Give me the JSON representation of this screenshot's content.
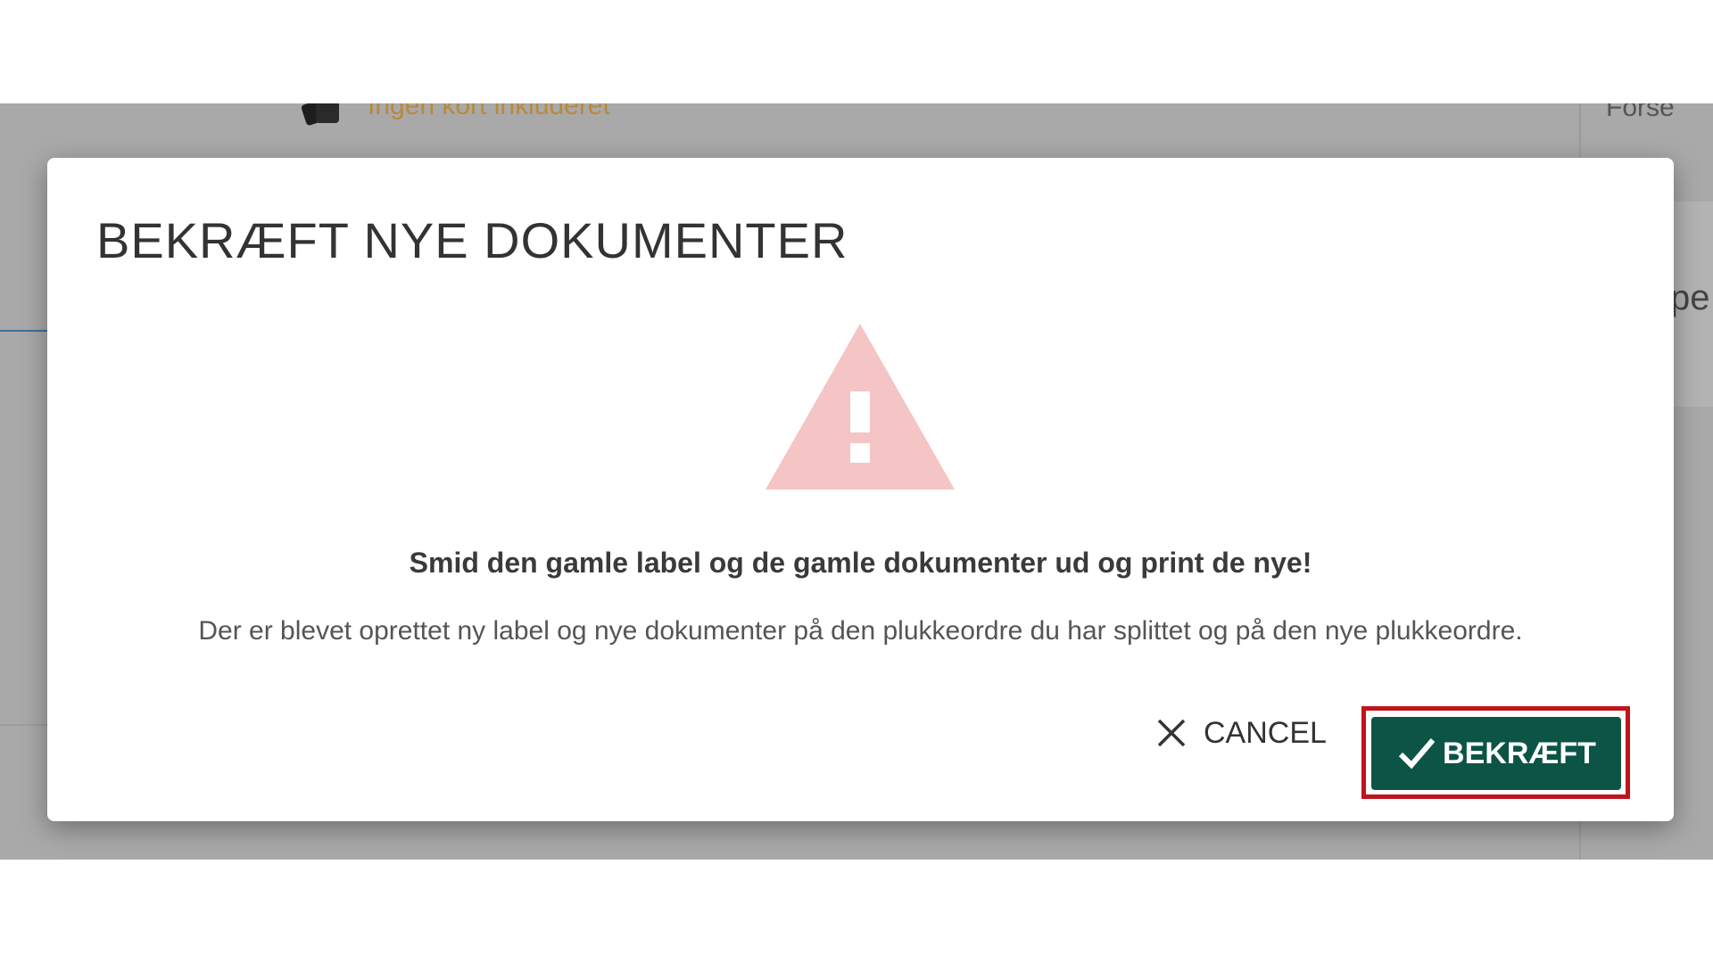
{
  "background": {
    "cards_status_text": "Ingen kort inkluderet",
    "right_panel_text": "Forse",
    "right_panel_fragment": "pe"
  },
  "dialog": {
    "title": "BEKRÆFT NYE DOKUMENTER",
    "warning_icon": "warning-triangle-icon",
    "warning_color": "#f5c4c4",
    "message_strong": "Smid den gamle label og de gamle dokumenter ud og print de nye!",
    "message_body": "Der er blevet oprettet ny label og nye dokumenter på den plukkeordre du har splittet og på den nye plukkeordre.",
    "cancel_label": "CANCEL",
    "confirm_label": "BEKRÆFT",
    "confirm_color": "#0b5446",
    "highlight_color": "#c0141c"
  },
  "fab_buttons": [
    {
      "icon": "plus-icon",
      "color": "#0b5446"
    },
    {
      "icon": "pencil-icon",
      "color": "#d2692a"
    },
    {
      "icon": "alert-icon",
      "color": "#8b1a1a"
    },
    {
      "icon": "car-icon",
      "color": "#b5b5b5"
    },
    {
      "icon": "split-icon",
      "color": "#b5b5b5"
    }
  ]
}
